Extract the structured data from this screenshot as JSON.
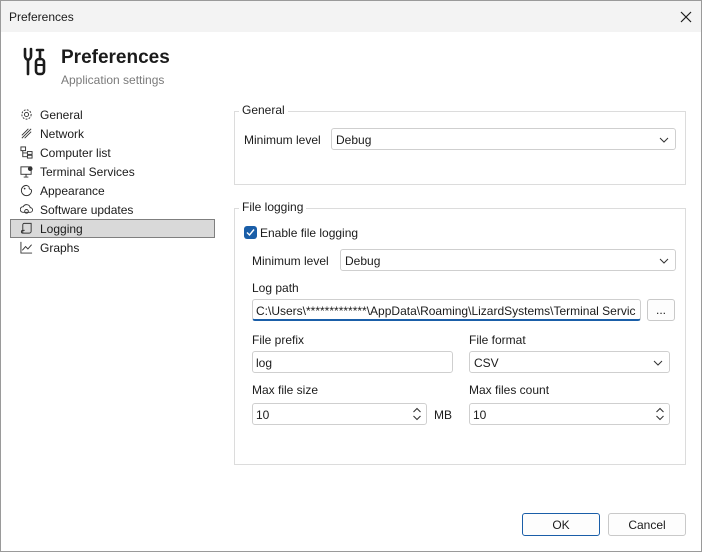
{
  "window": {
    "title": "Preferences"
  },
  "header": {
    "title": "Preferences",
    "subtitle": "Application settings"
  },
  "nav": {
    "items": [
      {
        "label": "General",
        "icon": "gear-icon"
      },
      {
        "label": "Network",
        "icon": "network-icon"
      },
      {
        "label": "Computer list",
        "icon": "computer-list-icon"
      },
      {
        "label": "Terminal Services",
        "icon": "terminal-services-icon"
      },
      {
        "label": "Appearance",
        "icon": "appearance-icon"
      },
      {
        "label": "Software updates",
        "icon": "software-updates-icon"
      },
      {
        "label": "Logging",
        "icon": "logging-icon",
        "active": true
      },
      {
        "label": "Graphs",
        "icon": "graph-icon"
      }
    ]
  },
  "general_group": {
    "title": "General",
    "min_level_label": "Minimum level",
    "min_level_value": "Debug"
  },
  "file_logging_group": {
    "title": "File logging",
    "enable_label": "Enable file logging",
    "enable_checked": true,
    "min_level_label": "Minimum level",
    "min_level_value": "Debug",
    "log_path_label": "Log path",
    "log_path_value": "C:\\Users\\*************\\AppData\\Roaming\\LizardSystems\\Terminal Servic",
    "browse_label": "...",
    "file_prefix_label": "File prefix",
    "file_prefix_value": "log",
    "file_format_label": "File format",
    "file_format_value": "CSV",
    "max_file_size_label": "Max file size",
    "max_file_size_value": "10",
    "max_file_size_unit": "MB",
    "max_files_count_label": "Max files count",
    "max_files_count_value": "10"
  },
  "buttons": {
    "ok": "OK",
    "cancel": "Cancel"
  },
  "colors": {
    "accent": "#1a5ea8",
    "selection": "#d9d9d9"
  }
}
